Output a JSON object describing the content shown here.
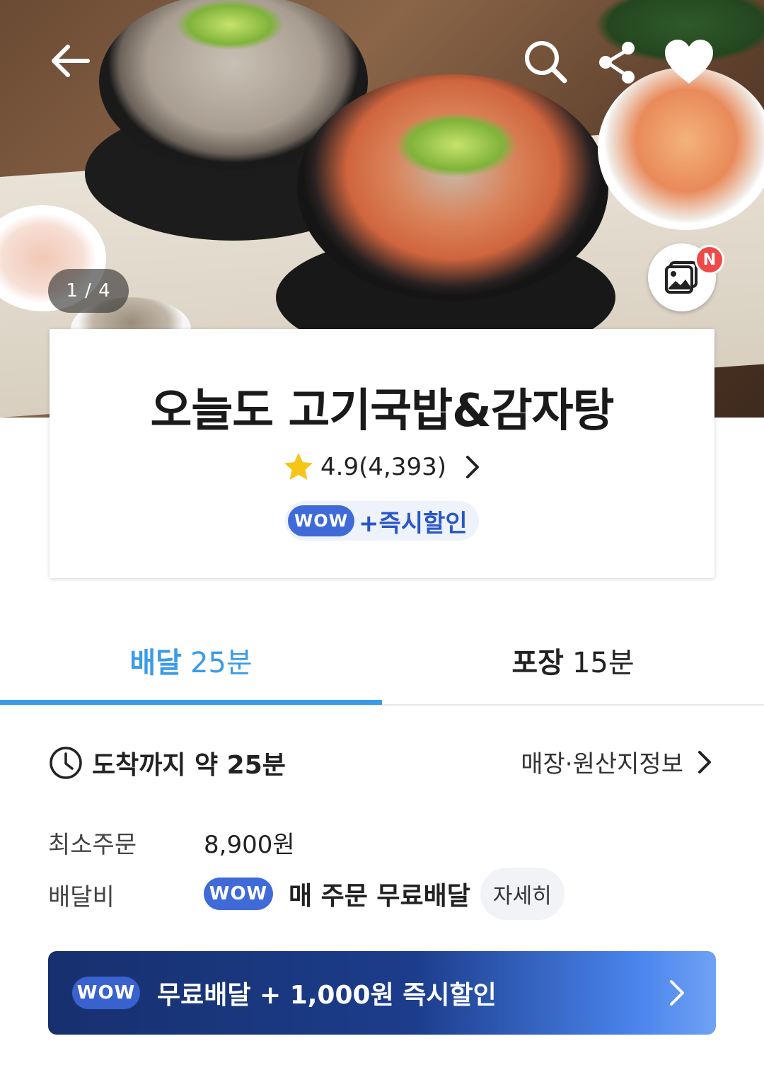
{
  "hero": {
    "image_counter": "1 / 4",
    "photo_badge": "N"
  },
  "store": {
    "name": "오늘도 고기국밥&감자탕",
    "rating": "4.9(4,393)",
    "wow_badge": "WOW",
    "wow_benefit": "+즉시할인"
  },
  "tabs": [
    {
      "label": "배달",
      "time": "25분",
      "active": true
    },
    {
      "label": "포장",
      "time": "15분",
      "active": false
    }
  ],
  "delivery": {
    "eta": "도착까지 약 25분",
    "store_info_link": "매장·원산지정보",
    "min_order_label": "최소주문",
    "min_order_value": "8,900원",
    "fee_label": "배달비",
    "fee_wow_badge": "WOW",
    "fee_text": "매 주문 무료배달",
    "detail_button": "자세히"
  },
  "promo": {
    "wow_badge": "WOW",
    "text": "무료배달 + 1,000원 즉시할인"
  },
  "colors": {
    "accent_blue": "#3a9be8",
    "wow_blue": "#3f6ad8",
    "promo_dark": "#17306e",
    "badge_red": "#ee4a4a",
    "star": "#f5c518"
  },
  "icons": [
    "back-arrow-icon",
    "search-icon",
    "share-icon",
    "heart-icon",
    "photo-review-icon",
    "star-icon",
    "chevron-right-icon",
    "clock-icon"
  ]
}
